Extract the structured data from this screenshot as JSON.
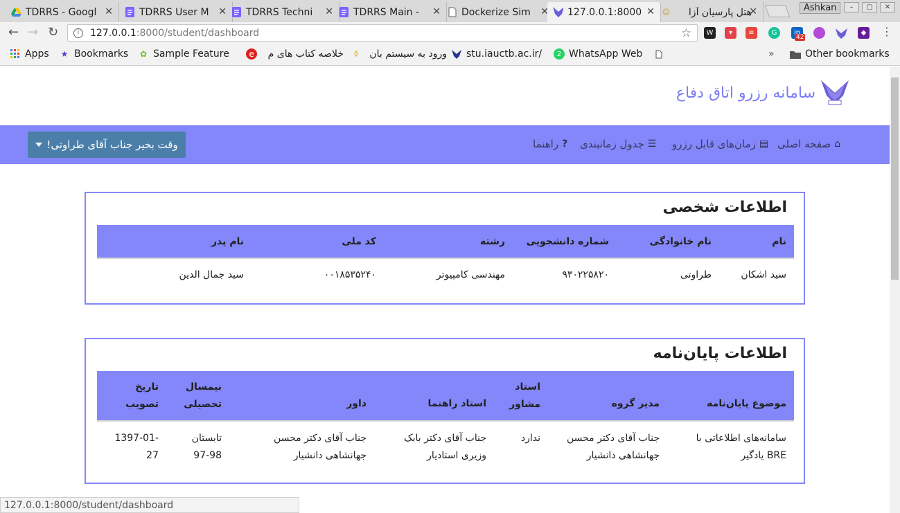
{
  "browser": {
    "tabs": [
      {
        "title": "TDRRS - Googl",
        "icon": "google-drive-icon",
        "active": false
      },
      {
        "title": "TDRRS User M",
        "icon": "google-docs-icon",
        "active": false
      },
      {
        "title": "TDRRS Techni",
        "icon": "google-docs-icon",
        "active": false
      },
      {
        "title": "TDRRS Main - ",
        "icon": "google-docs-icon",
        "active": false
      },
      {
        "title": "Dockerize Sim",
        "icon": "page-icon",
        "active": false
      },
      {
        "title": "127.0.0.1:8000",
        "icon": "university-logo-icon",
        "active": true
      },
      {
        "title": "هتل پارسیان آزا",
        "icon": "hotel-icon",
        "active": false
      }
    ],
    "user_name": "Ashkan",
    "url_host": "127.0.0.1",
    "url_path": ":8000/student/dashboard",
    "extension_badge": "42",
    "bookmarks": [
      {
        "label": "Apps",
        "icon": "apps-grid-icon"
      },
      {
        "label": "Bookmarks",
        "icon": "star-icon"
      },
      {
        "label": "Sample Feature I",
        "icon": "feature-icon"
      },
      {
        "label": "خلاصه کتاب های م",
        "icon": "e-logo-icon"
      },
      {
        "label": "ورود به سیستم بان",
        "icon": "bank-icon"
      },
      {
        "label": "stu.iauctb.ac.ir/",
        "icon": "university-logo-icon"
      },
      {
        "label": "WhatsApp Web",
        "icon": "whatsapp-icon"
      }
    ],
    "more_bookmarks": "»",
    "other_bookmarks": "Other bookmarks",
    "status_url": "127.0.0.1:8000/student/dashboard"
  },
  "site": {
    "brand_title": "سامانه رزرو اتاق دفاع",
    "nav": [
      {
        "label": "صفحه اصلی",
        "icon": "home-icon"
      },
      {
        "label": "زمان‌های قابل رزرو",
        "icon": "list-icon"
      },
      {
        "label": "جدول زمانبندی",
        "icon": "table-icon"
      },
      {
        "label": "راهنما",
        "icon": "question-icon"
      }
    ],
    "greeting": "وقت بخیر جناب آقای طراوتی!"
  },
  "personal": {
    "title": "اطلاعات شخصی",
    "headers": [
      "نام",
      "نام خانوادگی",
      "شماره دانشجویی",
      "رشته",
      "کد ملی",
      "نام پدر"
    ],
    "row": [
      "سید اشکان",
      "طراوتی",
      "۹۳۰۲۲۵۸۲۰",
      "مهندسی کامپیوتر",
      "۰۰۱۸۵۳۵۲۴۰",
      "سید جمال الدین"
    ]
  },
  "thesis": {
    "title": "اطلاعات پایان‌نامه",
    "headers": [
      "موضوع پایان‌نامه",
      "مدیر گروه",
      "استاد مشاور",
      "استاد راهنما",
      "داور",
      "نیمسال تحصیلی",
      "تاریخ تصویب"
    ],
    "row": [
      "سامانه‌های اطلاعاتی با BRE یادگیر",
      "جناب آقای دکتر محسن جهانشاهی دانشیار",
      "ندارد",
      "جناب آقای دکتر بابک وزیری استادیار",
      "جناب آقای دکتر محسن جهانشاهی دانشیار",
      "تابستان 98-97",
      "1397-01-27"
    ]
  },
  "colors": {
    "accent": "#8387fa",
    "brand_text": "#7b7ef2",
    "user_button": "#4b7faa"
  }
}
